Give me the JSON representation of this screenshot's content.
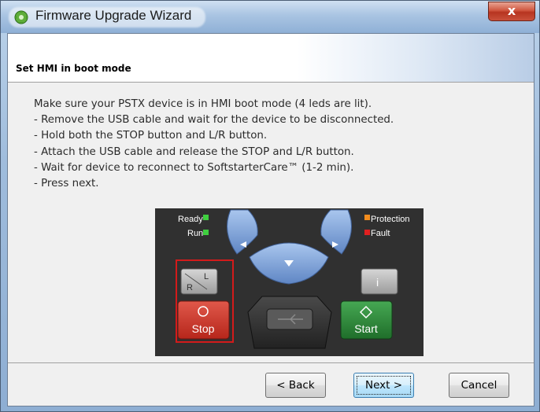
{
  "window": {
    "title": "Firmware Upgrade Wizard",
    "close_label": "x"
  },
  "header": {
    "title": "Set HMI in boot mode"
  },
  "instructions": [
    "Make sure your PSTX device is in HMI boot mode (4 leds are lit).",
    "- Remove the USB cable and wait for the device to be disconnected.",
    "- Hold both the STOP button and L/R button.",
    "- Attach the USB cable and release the STOP and L/R button.",
    "- Wait for device to reconnect to SoftstarterCare™ (1-2 min).",
    "- Press next."
  ],
  "panel": {
    "led_ready": "Ready",
    "led_run": "Run",
    "led_protection": "Protection",
    "led_fault": "Fault",
    "stop_label": "Stop",
    "start_label": "Start",
    "info_label": "i",
    "lr_label_l": "L",
    "lr_label_r": "R"
  },
  "buttons": {
    "back": "< Back",
    "next": "Next >",
    "cancel": "Cancel"
  },
  "colors": {
    "led_green": "#3fcf3f",
    "led_orange": "#f28c1e",
    "led_red": "#e02020",
    "nav_blue": "#7da4dc",
    "stop_red": "#d33a2c",
    "start_green": "#2f8f3a",
    "highlight": "#d31b1b"
  }
}
